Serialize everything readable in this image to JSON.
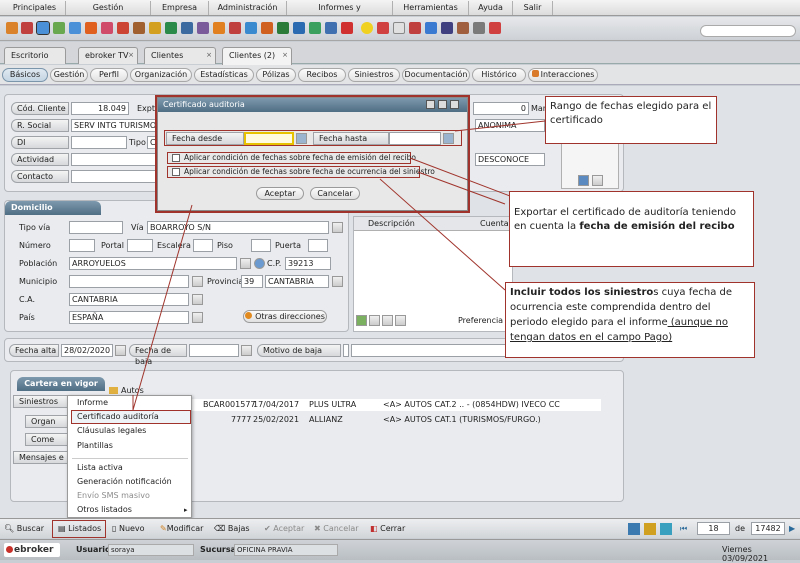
{
  "menu": [
    "Principales",
    "Gestión comercial",
    "Empresa",
    "Administración",
    "Informes y estadísticas",
    "Herramientas",
    "Ayuda",
    "Salir"
  ],
  "tabs": [
    {
      "label": "Escritorio"
    },
    {
      "label": "ebroker TV"
    },
    {
      "label": "Clientes"
    },
    {
      "label": "Clientes (2)"
    }
  ],
  "subtabs": [
    "Básicos",
    "Gestión",
    "Perfil",
    "Organización",
    "Estadísticas",
    "Pólizas",
    "Recibos",
    "Siniestros",
    "Documentación",
    "Histórico",
    "Interacciones"
  ],
  "client": {
    "cod_label": "Cód. Cliente",
    "cod_value": "18.049",
    "expt_label": "Expt",
    "rsocial_label": "R. Social",
    "rsocial_value": "SERV INTG TURISMO Y",
    "di_label": "DI",
    "tipo_label": "Tipo",
    "tipo_value": "CI",
    "actividad_label": "Actividad",
    "contacto_label": "Contacto",
    "right_num": "0",
    "right_label": "Manual",
    "anonima": "ANONIMA",
    "desconoce": "DESCONOCE"
  },
  "domicilio": {
    "title": "Domicilio",
    "tipovia_label": "Tipo vía",
    "via_label": "Vía",
    "via_value": "BOARROYO S/N",
    "numero_label": "Número",
    "portal_label": "Portal",
    "escalera_label": "Escalera",
    "piso_label": "Piso",
    "puerta_label": "Puerta",
    "poblacion_label": "Población",
    "poblacion_value": "ARROYUELOS",
    "cp_label": "C.P.",
    "cp_value": "39213",
    "municipio_label": "Municipio",
    "provincia_label": "Provincia",
    "provincia_code": "39",
    "provincia_value": "CANTABRIA",
    "ca_label": "C.A.",
    "ca_value": "CANTABRIA",
    "pais_label": "País",
    "pais_value": "ESPAÑA",
    "otras_direcciones": "Otras direcciones"
  },
  "doc_table": {
    "descripcion": "Descripción",
    "cuenta": "Cuenta",
    "preferencia": "Preferencia c"
  },
  "dates": {
    "alta_label": "Fecha alta",
    "alta_value": "28/02/2020",
    "baja_label": "Fecha de baja",
    "motivo_label": "Motivo de baja"
  },
  "cartera": {
    "title": "Cartera en vigor",
    "side": [
      "Siniestros",
      "Organ",
      "Come",
      "Mensajes e"
    ],
    "autos": "Autos",
    "rows": [
      {
        "code": "BCAR001577",
        "date": "17/04/2017",
        "company": "PLUS ULTRA",
        "desc": "<A> AUTOS CAT.2 .. - (0854HDW) IVECO CC"
      },
      {
        "code": "7777",
        "date": "25/02/2021",
        "company": "ALLIANZ",
        "desc": "<A> AUTOS CAT.1 (TURISMOS/FURGO.)"
      }
    ]
  },
  "dialog": {
    "title": "Certificado auditoria",
    "desde_label": "Fecha desde",
    "hasta_label": "Fecha hasta",
    "chk_emision": "Aplicar condición de fechas sobre fecha de emisión del recibo",
    "chk_ocurrencia": "Aplicar condición de fechas sobre fecha de ocurrencia del siniestro",
    "aceptar": "Aceptar",
    "cancelar": "Cancelar"
  },
  "popup": {
    "items": [
      "Informe",
      "Certificado auditoría",
      "Cláusulas legales",
      "Plantillas"
    ],
    "items2": [
      "Lista activa",
      "Generación notificación"
    ],
    "disabled": "Envío SMS masivo",
    "otros": "Otros listados"
  },
  "callouts": {
    "c1": "Rango de fechas elegido para el certificado",
    "c2_pre": "Exportar el certificado de auditoría teniendo en cuenta la ",
    "c2_bold": "fecha de emisión del recibo",
    "c3_bold": "Incluir todos los siniestro",
    "c3_mid": "s cuya fecha de ocurrencia este comprendida dentro del periodo elegido para el informe",
    "c3_under": " (aunque no tengan datos en el campo Pago)"
  },
  "bottombar": {
    "buscar": "Buscar",
    "listados": "Listados",
    "nuevo": "Nuevo",
    "modificar": "Modificar",
    "bajas": "Bajas",
    "aceptar": "Aceptar",
    "cancelar": "Cancelar",
    "cerrar": "Cerrar",
    "record": "18",
    "de": "de",
    "total": "17482"
  },
  "status": {
    "logo": "ebroker",
    "usuario_label": "Usuario",
    "usuario_value": "soraya",
    "sucursal_label": "Sucursal",
    "sucursal_value": "OFICINA PRAVIA",
    "date": "Viernes 03/09/2021"
  },
  "colors": {
    "accent": "#4f6d83",
    "callout_border": "#a0342c"
  }
}
